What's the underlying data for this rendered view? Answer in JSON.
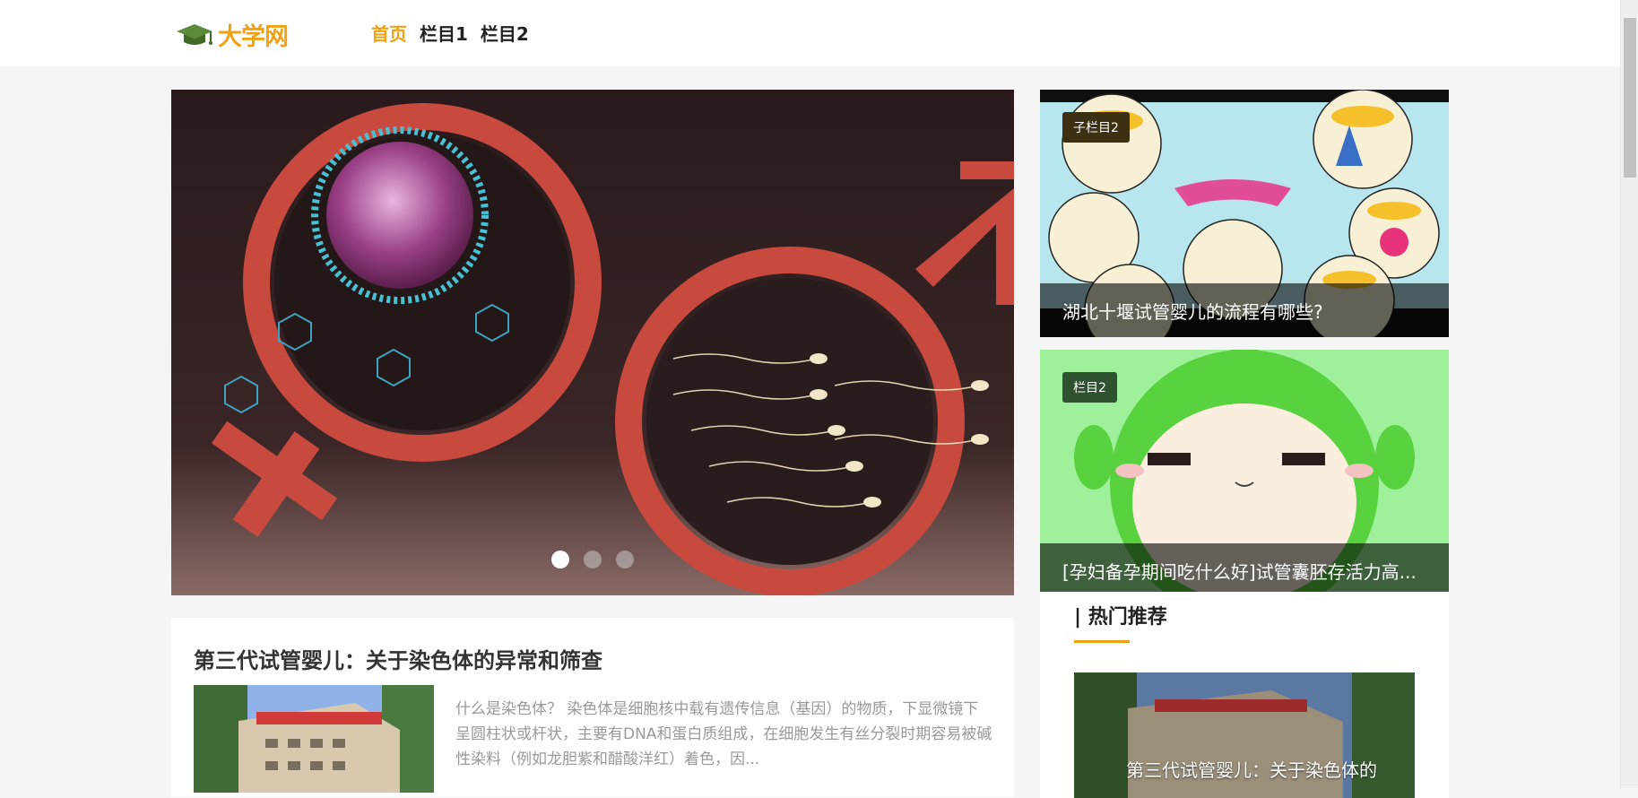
{
  "header": {
    "logo_text": "大学网",
    "nav": [
      {
        "label": "首页",
        "active": true
      },
      {
        "label": "栏目1",
        "active": false
      },
      {
        "label": "栏目2",
        "active": false
      }
    ]
  },
  "carousel": {
    "slide_count": 3,
    "active_index": 0
  },
  "features": [
    {
      "tag": "子栏目2",
      "caption": "湖北十堰试管婴儿的流程有哪些?"
    },
    {
      "tag": "栏目2",
      "caption": "[孕妇备孕期间吃什么好]试管囊胚存活力高..."
    }
  ],
  "article": {
    "title": "第三代试管婴儿：关于染色体的异常和筛查",
    "summary": "什么是染色体？ 染色体是细胞核中载有遗传信息（基因）的物质，下显微镜下呈圆柱状或杆状，主要有DNA和蛋白质组成，在细胞发生有丝分裂时期容易被碱性染料（例如龙胆紫和醋酸洋红）着色，因..."
  },
  "hot": {
    "title": "| 热门推荐",
    "item_caption": "第三代试管婴儿：关于染色体的"
  },
  "colors": {
    "accent": "#f0a215",
    "header_bg": "#ffffff",
    "page_bg": "#f5f5f5"
  }
}
